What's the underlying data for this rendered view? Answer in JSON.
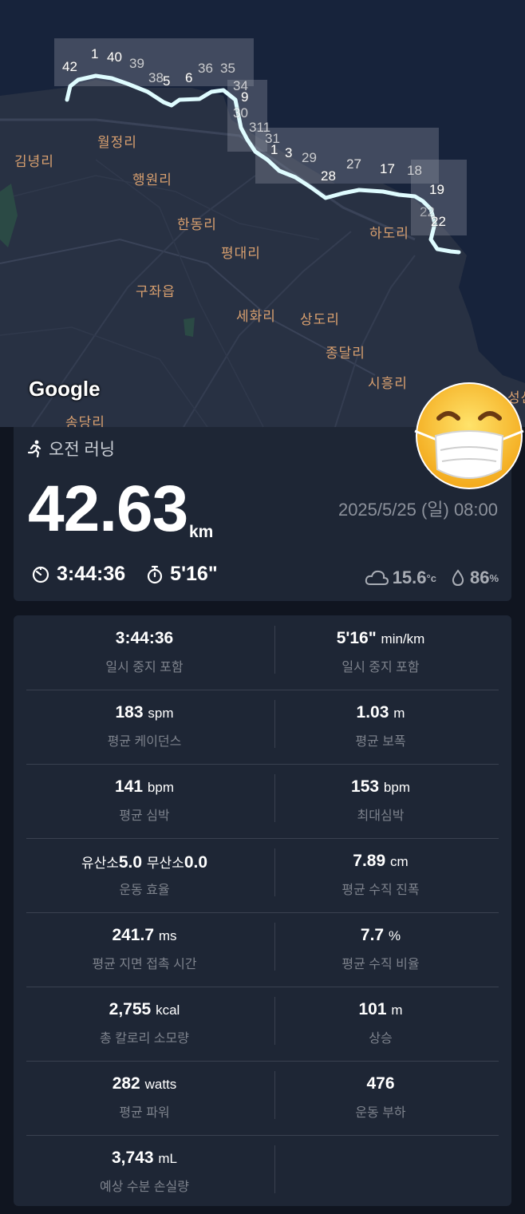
{
  "map": {
    "google_logo": "Google",
    "places": [
      "김녕리",
      "월정리",
      "행원리",
      "한동리",
      "평대리",
      "구좌읍",
      "세화리",
      "상도리",
      "종달리",
      "시흥리",
      "하도리",
      "송당리",
      "성산"
    ],
    "markers": [
      "42",
      "1",
      "40",
      "39",
      "38",
      "5",
      "6",
      "36",
      "35",
      "34",
      "9",
      "30",
      "311",
      "31",
      "1",
      "3",
      "29",
      "28",
      "27",
      "17",
      "18",
      "19",
      "22",
      "22"
    ]
  },
  "summary": {
    "activity": "오전 러닝",
    "distance": "42.63",
    "distance_unit": "km",
    "datetime": "2025/5/25 (일) 08:00",
    "duration": "3:44:36",
    "pace": "5'16\"",
    "temperature": "15.6",
    "temperature_unit": "°c",
    "humidity": "86",
    "humidity_unit": "%"
  },
  "stats": [
    {
      "left": {
        "value": "3:44:36",
        "unit": "",
        "label": "일시 중지 포함"
      },
      "right": {
        "value": "5'16\"",
        "unit": "min/km",
        "label": "일시 중지 포함"
      }
    },
    {
      "left": {
        "value": "183",
        "unit": "spm",
        "label": "평균 케이던스"
      },
      "right": {
        "value": "1.03",
        "unit": "m",
        "label": "평균 보폭"
      }
    },
    {
      "left": {
        "value": "141",
        "unit": "bpm",
        "label": "평균 심박"
      },
      "right": {
        "value": "153",
        "unit": "bpm",
        "label": "최대심박"
      }
    },
    {
      "left": {
        "prefix1": "유산소",
        "value1": "5.0",
        "prefix2": "무산소",
        "value2": "0.0",
        "label": "운동 효율"
      },
      "right": {
        "value": "7.89",
        "unit": "cm",
        "label": "평균 수직 진폭"
      }
    },
    {
      "left": {
        "value": "241.7",
        "unit": "ms",
        "label": "평균 지면 접촉 시간"
      },
      "right": {
        "value": "7.7",
        "unit": "%",
        "label": "평균 수직 비율"
      }
    },
    {
      "left": {
        "value": "2,755",
        "unit": "kcal",
        "label": "총 칼로리 소모량"
      },
      "right": {
        "value": "101",
        "unit": "m",
        "label": "상승"
      }
    },
    {
      "left": {
        "value": "282",
        "unit": "watts",
        "label": "평균 파워"
      },
      "right": {
        "value": "476",
        "unit": "",
        "label": "운동 부하"
      }
    },
    {
      "left": {
        "value": "3,743",
        "unit": "mL",
        "label": "예상 수분 손실량"
      },
      "right": {
        "value": "",
        "unit": "",
        "label": ""
      }
    }
  ],
  "colors": {
    "route": "#dffcff",
    "map_land": "#283143",
    "map_sea": "#17233b",
    "place_label": "#d9a06f"
  }
}
